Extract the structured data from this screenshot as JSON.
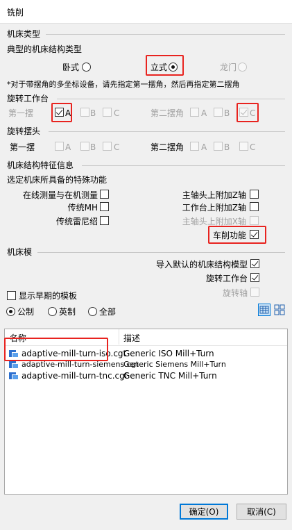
{
  "window": {
    "title": "铣削"
  },
  "machine_type": {
    "group_label": "机床类型",
    "structure_label": "典型的机床结构类型",
    "options": [
      {
        "label": "卧式",
        "selected": false,
        "enabled": true
      },
      {
        "label": "立式",
        "selected": true,
        "enabled": true
      },
      {
        "label": "龙门",
        "selected": false,
        "enabled": false
      }
    ],
    "note": "*对于带摆角的多坐标设备，请先指定第一摆角，然后再指定第二摆角"
  },
  "rotary_table": {
    "group_label": "旋转工作台",
    "first_label": "第一摆",
    "second_label": "第二摆角",
    "first_axes": [
      {
        "label": "A",
        "checked": true,
        "enabled": true
      },
      {
        "label": "B",
        "checked": false,
        "enabled": false
      },
      {
        "label": "C",
        "checked": false,
        "enabled": false
      }
    ],
    "second_axes": [
      {
        "label": "A",
        "checked": false,
        "enabled": false
      },
      {
        "label": "B",
        "checked": false,
        "enabled": false
      },
      {
        "label": "C",
        "checked": true,
        "enabled": false
      }
    ]
  },
  "rotary_head": {
    "group_label": "旋转摆头",
    "first_label": "第一摆",
    "second_label": "第二摆角",
    "axes_labels": [
      "A",
      "B",
      "C"
    ]
  },
  "features": {
    "group_label": "机床结构特征信息",
    "prompt": "选定机床所具备的特殊功能",
    "left": [
      {
        "label": "在线测量与在机测量",
        "checked": false
      },
      {
        "label": "传统MH",
        "checked": false
      },
      {
        "label": "传统雷尼绍",
        "checked": false
      }
    ],
    "right": [
      {
        "label": "主轴头上附加Z轴",
        "checked": false,
        "enabled": true
      },
      {
        "label": "工作台上附加Z轴",
        "checked": false,
        "enabled": true
      },
      {
        "label": "主轴头上附加X轴",
        "checked": false,
        "enabled": false
      },
      {
        "label": "车削功能",
        "checked": true,
        "enabled": true
      }
    ]
  },
  "machine_model": {
    "group_label": "机床模",
    "import_default": {
      "label": "导入默认的机床结构模型",
      "checked": true
    },
    "rotary_table": {
      "label": "旋转工作台",
      "checked": true
    },
    "rotary_axis": {
      "label": "旋转轴",
      "checked": false,
      "enabled": false
    },
    "show_early": {
      "label": "显示早期的模板",
      "checked": false
    },
    "units": [
      {
        "label": "公制",
        "selected": true
      },
      {
        "label": "英制",
        "selected": false
      },
      {
        "label": "全部",
        "selected": false
      }
    ]
  },
  "template_list": {
    "columns": [
      "名称",
      "描述"
    ],
    "rows": [
      {
        "name": "adaptive-mill-turn-iso.cgt",
        "desc": "Generic ISO Mill+Turn"
      },
      {
        "name": "adaptive-mill-turn-siemens.cgt",
        "desc": "Generic Siemens Mill+Turn"
      },
      {
        "name": "adaptive-mill-turn-tnc.cgt",
        "desc": "Generic TNC Mill+Turn"
      }
    ]
  },
  "buttons": {
    "ok": "确定(O)",
    "cancel": "取消(C)"
  },
  "colors": {
    "highlight": "#e8231f",
    "accent": "#0078d7"
  }
}
